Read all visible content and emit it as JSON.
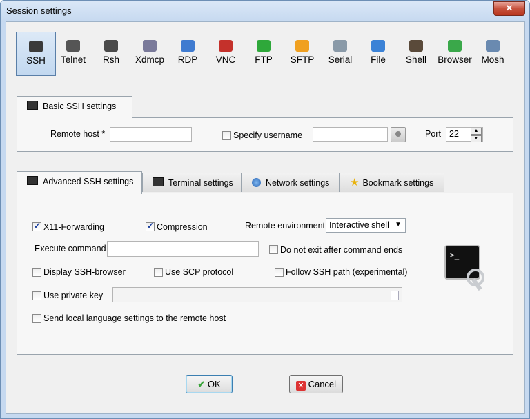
{
  "window": {
    "title": "Session settings",
    "close": "✕"
  },
  "protocols": [
    {
      "label": "SSH",
      "selected": true,
      "color": "#3a3a3a"
    },
    {
      "label": "Telnet",
      "color": "#555555"
    },
    {
      "label": "Rsh",
      "color": "#4a4a4a"
    },
    {
      "label": "Xdmcp",
      "color": "#7a7a9a"
    },
    {
      "label": "RDP",
      "color": "#3f7bd0"
    },
    {
      "label": "VNC",
      "color": "#c4312b"
    },
    {
      "label": "FTP",
      "color": "#2ea83a"
    },
    {
      "label": "SFTP",
      "color": "#f0a020"
    },
    {
      "label": "Serial",
      "color": "#8a9aa8"
    },
    {
      "label": "File",
      "color": "#3b82d6"
    },
    {
      "label": "Shell",
      "color": "#5a4a3a"
    },
    {
      "label": "Browser",
      "color": "#3aa84a"
    },
    {
      "label": "Mosh",
      "color": "#6a8ab0"
    }
  ],
  "basic": {
    "tab": "Basic SSH settings",
    "remote_host_label": "Remote host *",
    "remote_host_value": "",
    "specify_username_label": "Specify username",
    "username_value": "",
    "port_label": "Port",
    "port_value": "22"
  },
  "advanced_tabs": [
    "Advanced SSH settings",
    "Terminal settings",
    "Network settings",
    "Bookmark settings"
  ],
  "advanced": {
    "x11": "X11-Forwarding",
    "compression": "Compression",
    "remote_env_label": "Remote environment",
    "remote_env_value": "Interactive shell",
    "exec_label": "Execute command",
    "exec_value": "",
    "no_exit": "Do not exit after command ends",
    "ssh_browser": "Display SSH-browser",
    "scp": "Use SCP protocol",
    "follow_path": "Follow SSH path (experimental)",
    "private_key": "Use private key",
    "private_key_value": "",
    "send_lang": "Send local language settings to the remote host"
  },
  "buttons": {
    "ok": "OK",
    "cancel": "Cancel"
  }
}
